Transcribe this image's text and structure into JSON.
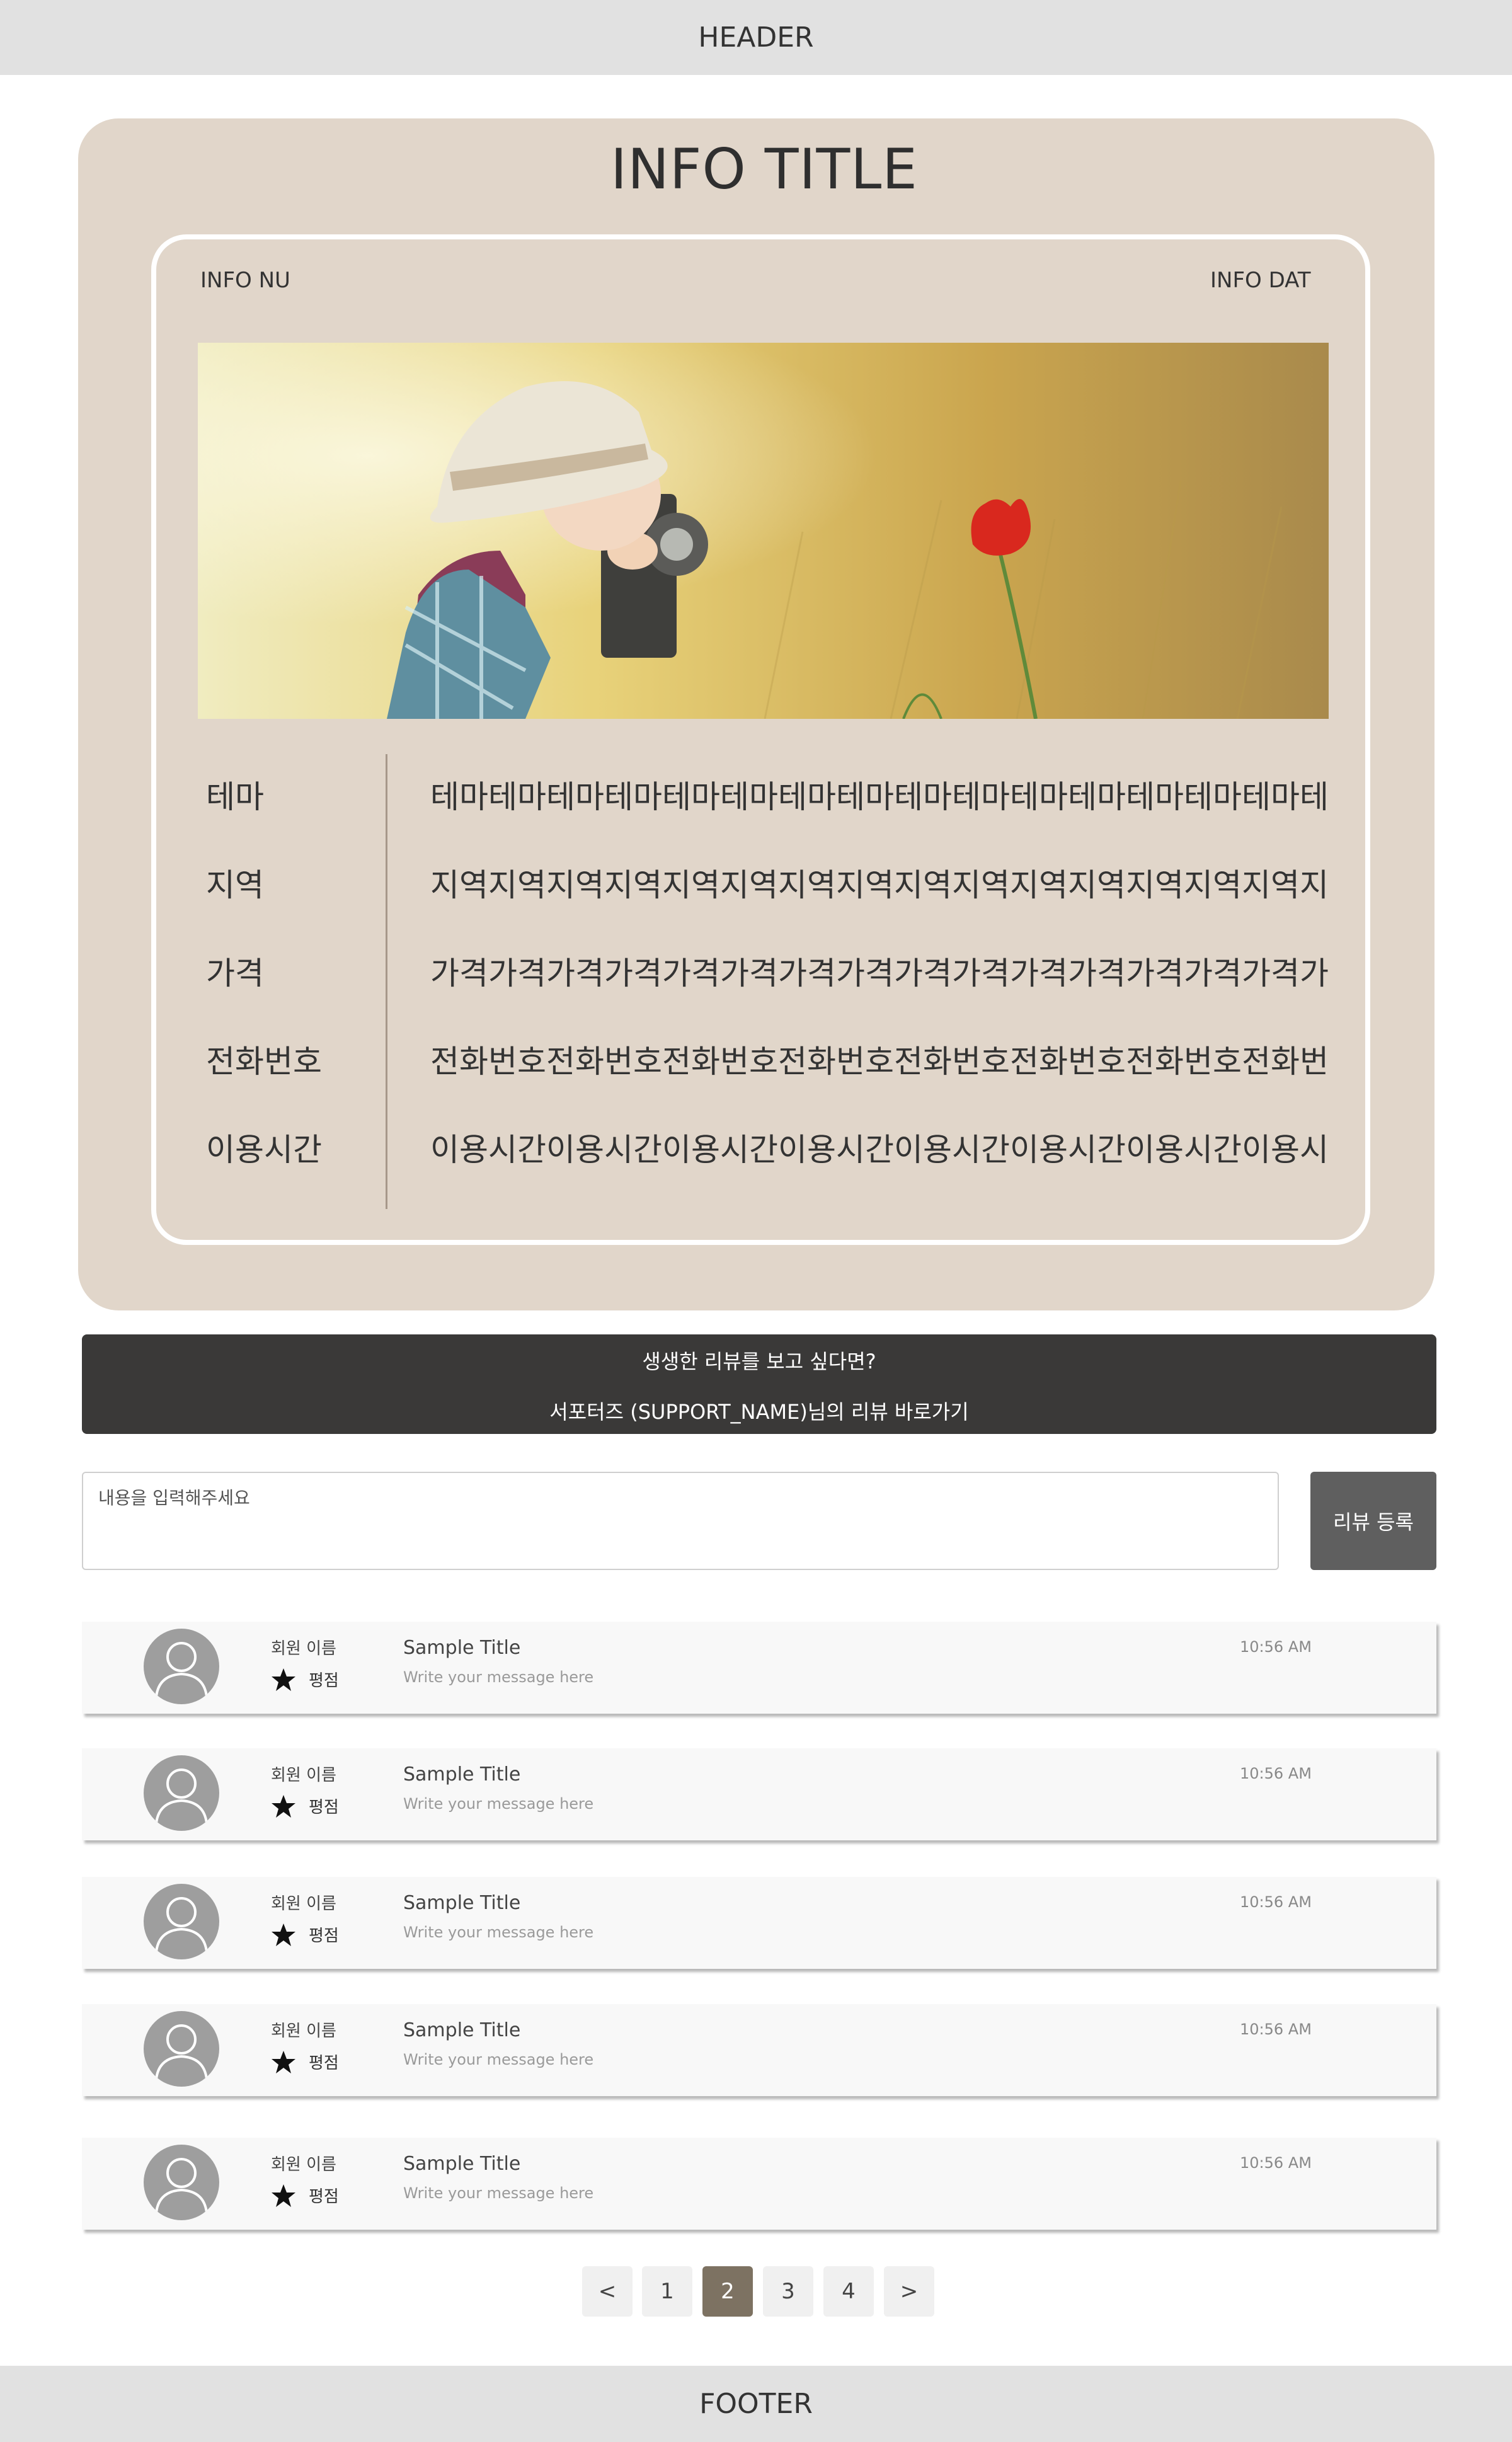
{
  "header": {
    "label": "HEADER"
  },
  "footer": {
    "label": "FOOTER"
  },
  "info": {
    "title": "INFO TITLE",
    "number_label": "INFO NU",
    "date_label": "INFO DAT",
    "image_icon": "photo-child-with-camera-and-red-flower",
    "rows": [
      {
        "label": "테마",
        "value": "테마테마테마테마테마테마테마테마테마테마테마테마테마테마테마테"
      },
      {
        "label": "지역",
        "value": "지역지역지역지역지역지역지역지역지역지역지역지역지역지역지역지"
      },
      {
        "label": "가격",
        "value": "가격가격가격가격가격가격가격가격가격가격가격가격가격가격가격가"
      },
      {
        "label": "전화번호",
        "value": "전화번호전화번호전화번호전화번호전화번호전화번호전화번호전화번"
      },
      {
        "label": "이용시간",
        "value": "이용시간이용시간이용시간이용시간이용시간이용시간이용시간이용시"
      }
    ]
  },
  "banner": {
    "line1": "생생한 리뷰를 보고 싶다면?",
    "line2": "서포터즈 (SUPPORT_NAME)님의 리뷰 바로가기"
  },
  "review_form": {
    "placeholder": "내용을 입력해주세요",
    "submit_label": "리뷰 등록"
  },
  "reviews": [
    {
      "member": "회원 이름",
      "rating_label": "평점",
      "title": "Sample Title",
      "message": "Write your message here",
      "time": "10:56 AM"
    },
    {
      "member": "회원 이름",
      "rating_label": "평점",
      "title": "Sample Title",
      "message": "Write your message here",
      "time": "10:56 AM"
    },
    {
      "member": "회원 이름",
      "rating_label": "평점",
      "title": "Sample Title",
      "message": "Write your message here",
      "time": "10:56 AM"
    },
    {
      "member": "회원 이름",
      "rating_label": "평점",
      "title": "Sample Title",
      "message": "Write your message here",
      "time": "10:56 AM"
    },
    {
      "member": "회원 이름",
      "rating_label": "평점",
      "title": "Sample Title",
      "message": "Write your message here",
      "time": "10:56 AM"
    }
  ],
  "pagination": {
    "prev": "<",
    "pages": [
      "1",
      "2",
      "3",
      "4"
    ],
    "current": "2",
    "next": ">"
  },
  "colors": {
    "card_bg": "#e1d6ca",
    "banner_bg": "#3a3938",
    "active_page": "#7d7262",
    "submit_bg": "#5f5f5f"
  }
}
